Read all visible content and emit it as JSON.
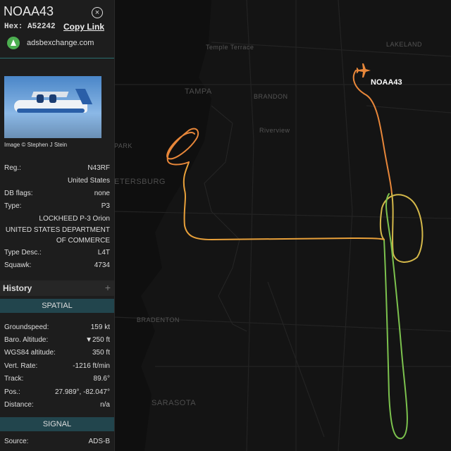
{
  "map": {
    "cities": [
      {
        "name": "Temple Terrace",
        "cls": "city"
      },
      {
        "name": "LAKELAND",
        "cls": "city"
      },
      {
        "name": "TAMPA",
        "cls": "city big"
      },
      {
        "name": "BRANDON",
        "cls": "city"
      },
      {
        "name": "Riverview",
        "cls": "city"
      },
      {
        "name": "PARK",
        "cls": "city"
      },
      {
        "name": "ETERSBURG",
        "cls": "city big"
      },
      {
        "name": "BRADENTON",
        "cls": "city"
      },
      {
        "name": "SARASOTA",
        "cls": "city big"
      }
    ],
    "aircraft_label": "NOAA43",
    "track_colors": {
      "orange": "#e8873a",
      "yellow": "#d4b84a",
      "green": "#7cc24e"
    }
  },
  "panel": {
    "callsign": "NOAA43",
    "close_icon": "×",
    "hex_label": "Hex:",
    "hex": "A52242",
    "copy_link": "Copy Link",
    "site": "adsbexchange.com",
    "photo_credit": "Image © Stephen J Stein",
    "details": {
      "reg_label": "Reg.:",
      "reg": "N43RF",
      "country": "United States",
      "db_flags_label": "DB flags:",
      "db_flags": "none",
      "type_label": "Type:",
      "type": "P3",
      "model": "LOCKHEED P-3 Orion",
      "owner_line1": "UNITED STATES DEPARTMENT",
      "owner_line2": "OF COMMERCE",
      "type_desc_label": "Type Desc.:",
      "type_desc": "L4T",
      "squawk_label": "Squawk:",
      "squawk": "4734"
    },
    "history": "History",
    "history_plus": "+",
    "spatial_title": "SPATIAL",
    "spatial": [
      {
        "label": "Groundspeed:",
        "value": "159 kt"
      },
      {
        "label": "Baro. Altitude:",
        "value": "▼250 ft"
      },
      {
        "label": "WGS84 altitude:",
        "value": "350 ft"
      },
      {
        "label": "Vert. Rate:",
        "value": "-1216 ft/min"
      },
      {
        "label": "Track:",
        "value": "89.6°"
      },
      {
        "label": "Pos.:",
        "value": "27.989°, -82.047°"
      },
      {
        "label": "Distance:",
        "value": "n/a"
      }
    ],
    "signal_title": "SIGNAL",
    "signal": [
      {
        "label": "Source:",
        "value": "ADS-B"
      }
    ]
  }
}
